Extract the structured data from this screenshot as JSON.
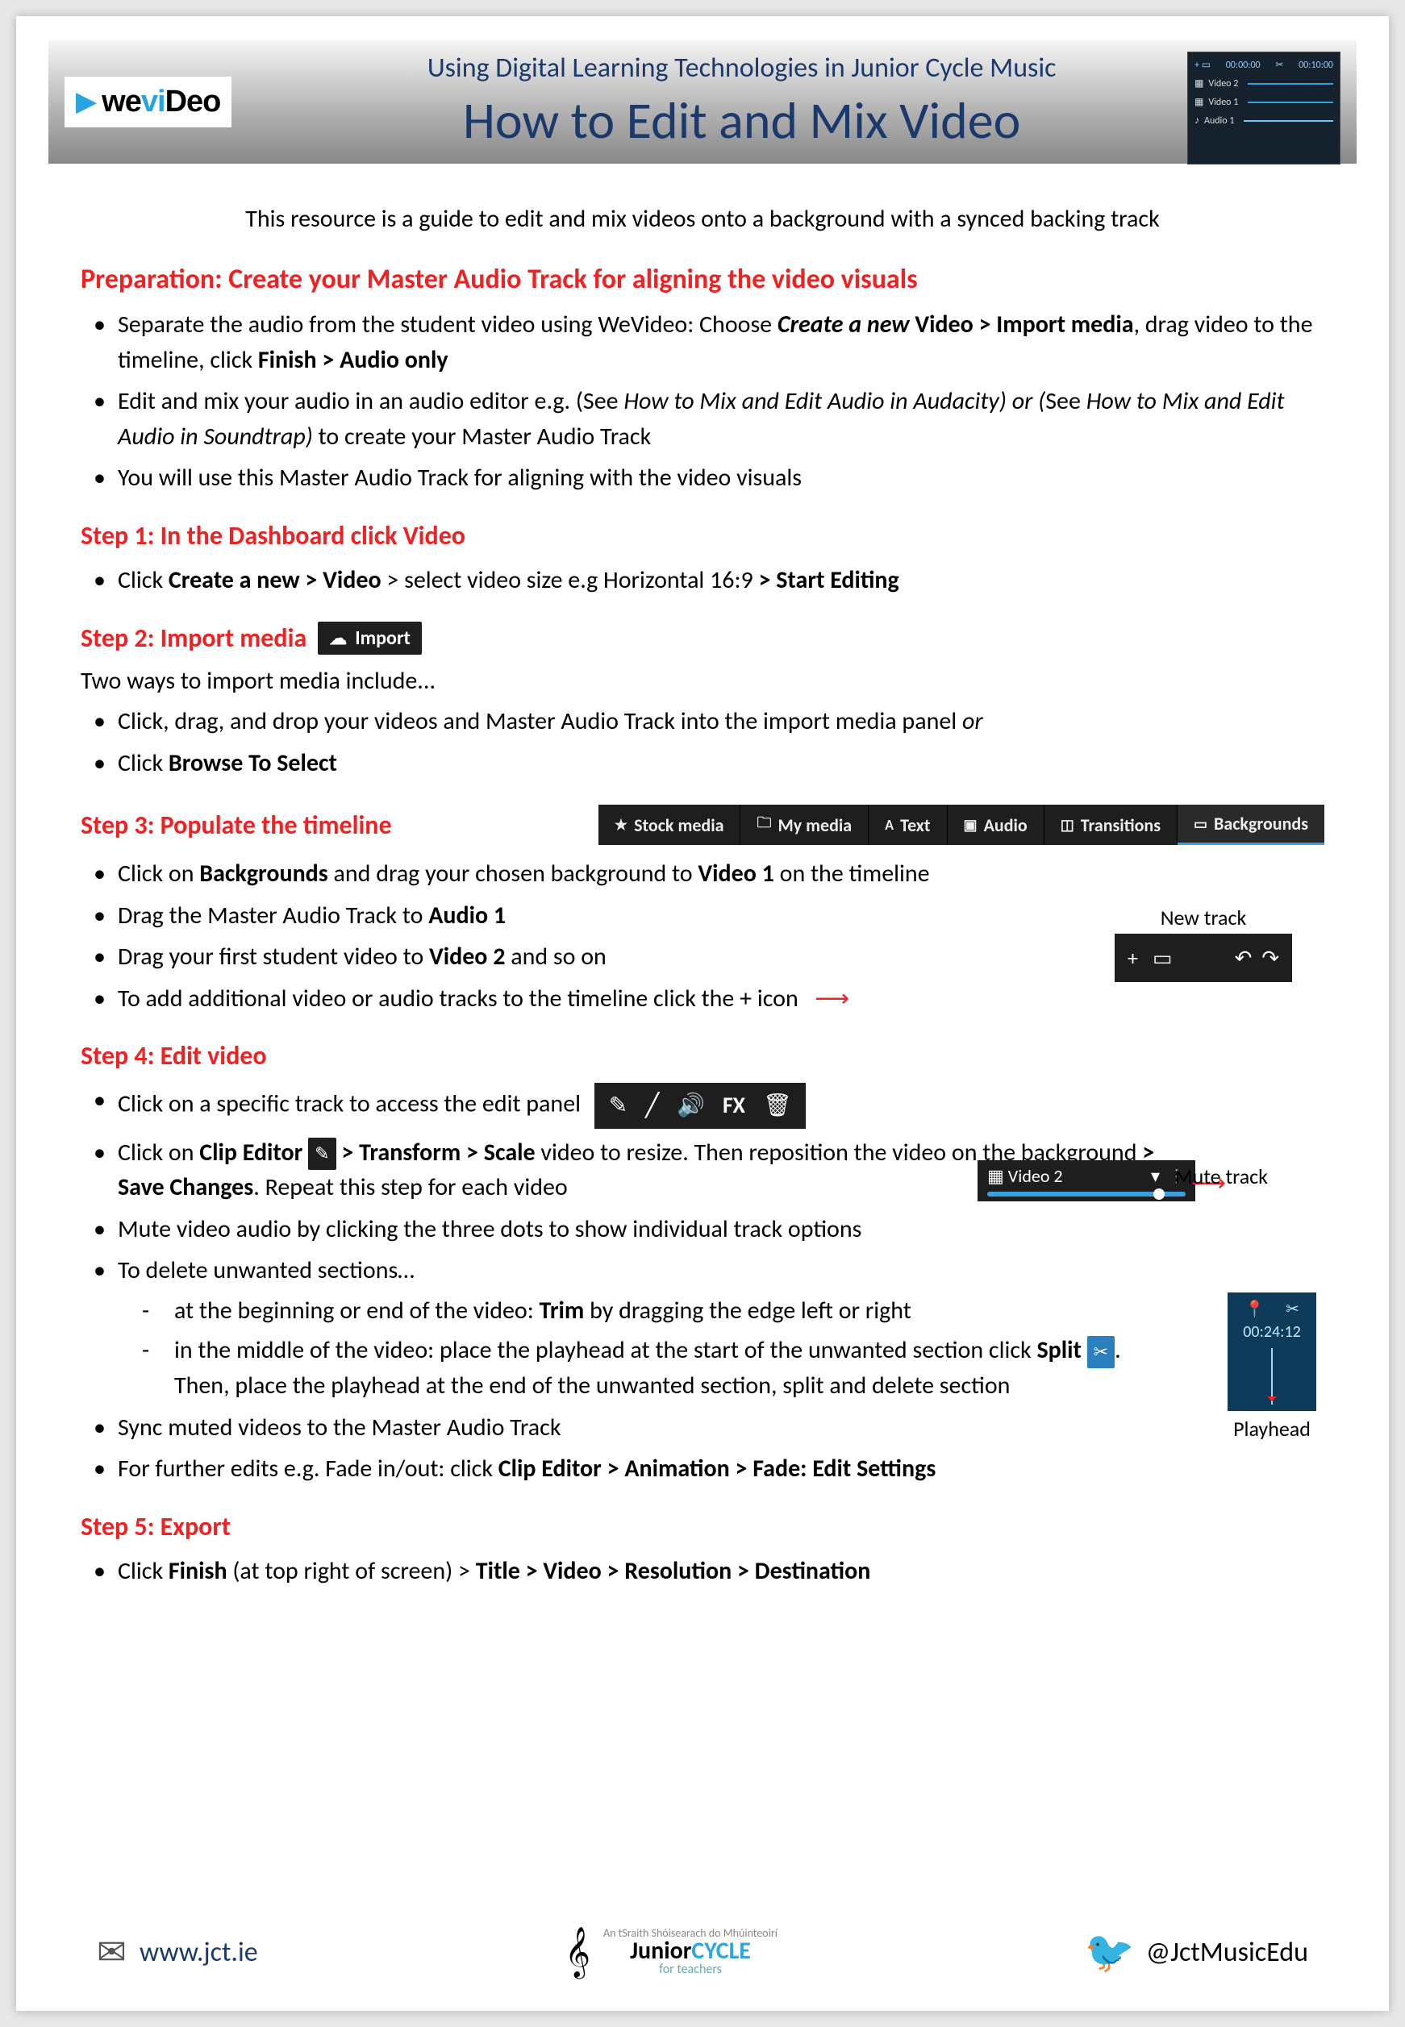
{
  "banner": {
    "logo_we": "we",
    "logo_vi": "vi",
    "logo_deo": "Deo",
    "subtitle": "Using Digital Learning Technologies in Junior Cycle Music",
    "title": "How to Edit and Mix Video",
    "thumb": {
      "timecode_left": "00:00:00",
      "timecode_right": "00:10:00",
      "tracks": [
        "Video 2",
        "Video 1",
        "Audio 1"
      ]
    }
  },
  "intro": "This resource is a guide to edit and mix videos onto a background with a synced backing track",
  "prep": {
    "heading": "Preparation: Create your Master Audio Track for aligning the video visuals",
    "items": [
      {
        "pre": "Separate the audio from the student video using WeVideo: Choose ",
        "ci": "Create a new",
        "b1": " Video > Import media",
        "mid": ", drag video to the timeline, click ",
        "b2": "Finish > Audio only"
      },
      {
        "pre": "Edit and mix your audio in an audio editor e.g. (See ",
        "i1": "How to Mix and Edit Audio in Audacity) or (",
        "mid": "See ",
        "i2": "How to Mix and Edit Audio in Soundtrap)",
        "post": " to create your Master Audio Track"
      },
      {
        "plain": "You will use this Master Audio Track for aligning with the video visuals"
      }
    ]
  },
  "step1": {
    "heading": "Step 1: In the Dashboard click Video",
    "item": {
      "pre": "Click ",
      "b1": "Create a new > Video",
      "mid1": " > select ",
      "mid2": "video size e.g Horizontal 16:9 ",
      "b2": "> Start Editing"
    }
  },
  "step2": {
    "heading": "Step 2: Import media",
    "chip": "Import",
    "note": "Two ways to import media include...",
    "items": [
      {
        "pre": "Click, drag, and drop your videos and Master Audio Track into the import media panel ",
        "i": "or"
      },
      {
        "pre": "Click ",
        "b": "Browse To Select"
      }
    ]
  },
  "step3": {
    "heading": "Step 3: Populate the timeline",
    "tabs": [
      "Stock media",
      "My media",
      "Text",
      "Audio",
      "Transitions",
      "Backgrounds"
    ],
    "items": [
      {
        "pre": "Click on ",
        "b1": "Backgrounds",
        "mid": " and drag your chosen background to ",
        "b2": "Video 1",
        "post": " on the timeline"
      },
      {
        "pre": "Drag the Master Audio Track to ",
        "b1": "Audio 1"
      },
      {
        "pre": "Drag your first student video to ",
        "b1": "Video 2",
        "post": " and so on"
      },
      {
        "plain": "To add additional video or audio tracks to the timeline click the + icon"
      }
    ],
    "newtrack_label": "New track"
  },
  "step4": {
    "heading": "Step 4: Edit video",
    "edit_icons": [
      "✎",
      "╱",
      "🔊",
      "FX",
      "🗑"
    ],
    "items": {
      "a": "Click on a specific track to access the edit panel",
      "b_pre": "Click on ",
      "b_b1": "Clip Editor",
      "b_mid1": " > ",
      "b_b2": "Transform > Scale",
      "b_mid2": " video to resize. Then reposition the video on the background ",
      "b_b3": "> Save Changes",
      "b_post": ". Repeat this step for each video",
      "c": "Mute video audio by clicking the three dots to show individual track options",
      "d": "To delete unwanted sections…",
      "d1_pre": "at the beginning or end of the video: ",
      "d1_b": "Trim",
      "d1_post": " by dragging the edge left or right",
      "d2_pre": "in the middle of the video: place the playhead at the start of the unwanted section click ",
      "d2_b": "Split",
      "d2_post": ". Then, place the playhead at the end of the unwanted section, split and delete section",
      "e": "Sync muted videos to the Master Audio Track",
      "f_pre": "For further edits e.g. Fade in/out: click ",
      "f_b": "Clip Editor > Animation > Fade: Edit Settings"
    },
    "track_chip": {
      "name": "Video 2"
    },
    "mute_label": "Mute track",
    "playhead_time": "00:24:12",
    "playhead_label": "Playhead"
  },
  "step5": {
    "heading": "Step 5: Export",
    "item": {
      "pre": "Click ",
      "b1": "Finish",
      "mid": " (at top right of screen) > ",
      "b2": "Title > Video > Resolution > Destination"
    }
  },
  "footer": {
    "url": "www.jct.ie",
    "jc_small": "An tSraith Shóisearach do Mhúinteoirí",
    "jc_junior": "Junior",
    "jc_cycle": "CYCLE",
    "jc_sub": "for teachers",
    "twitter": "@JctMusicEdu"
  }
}
